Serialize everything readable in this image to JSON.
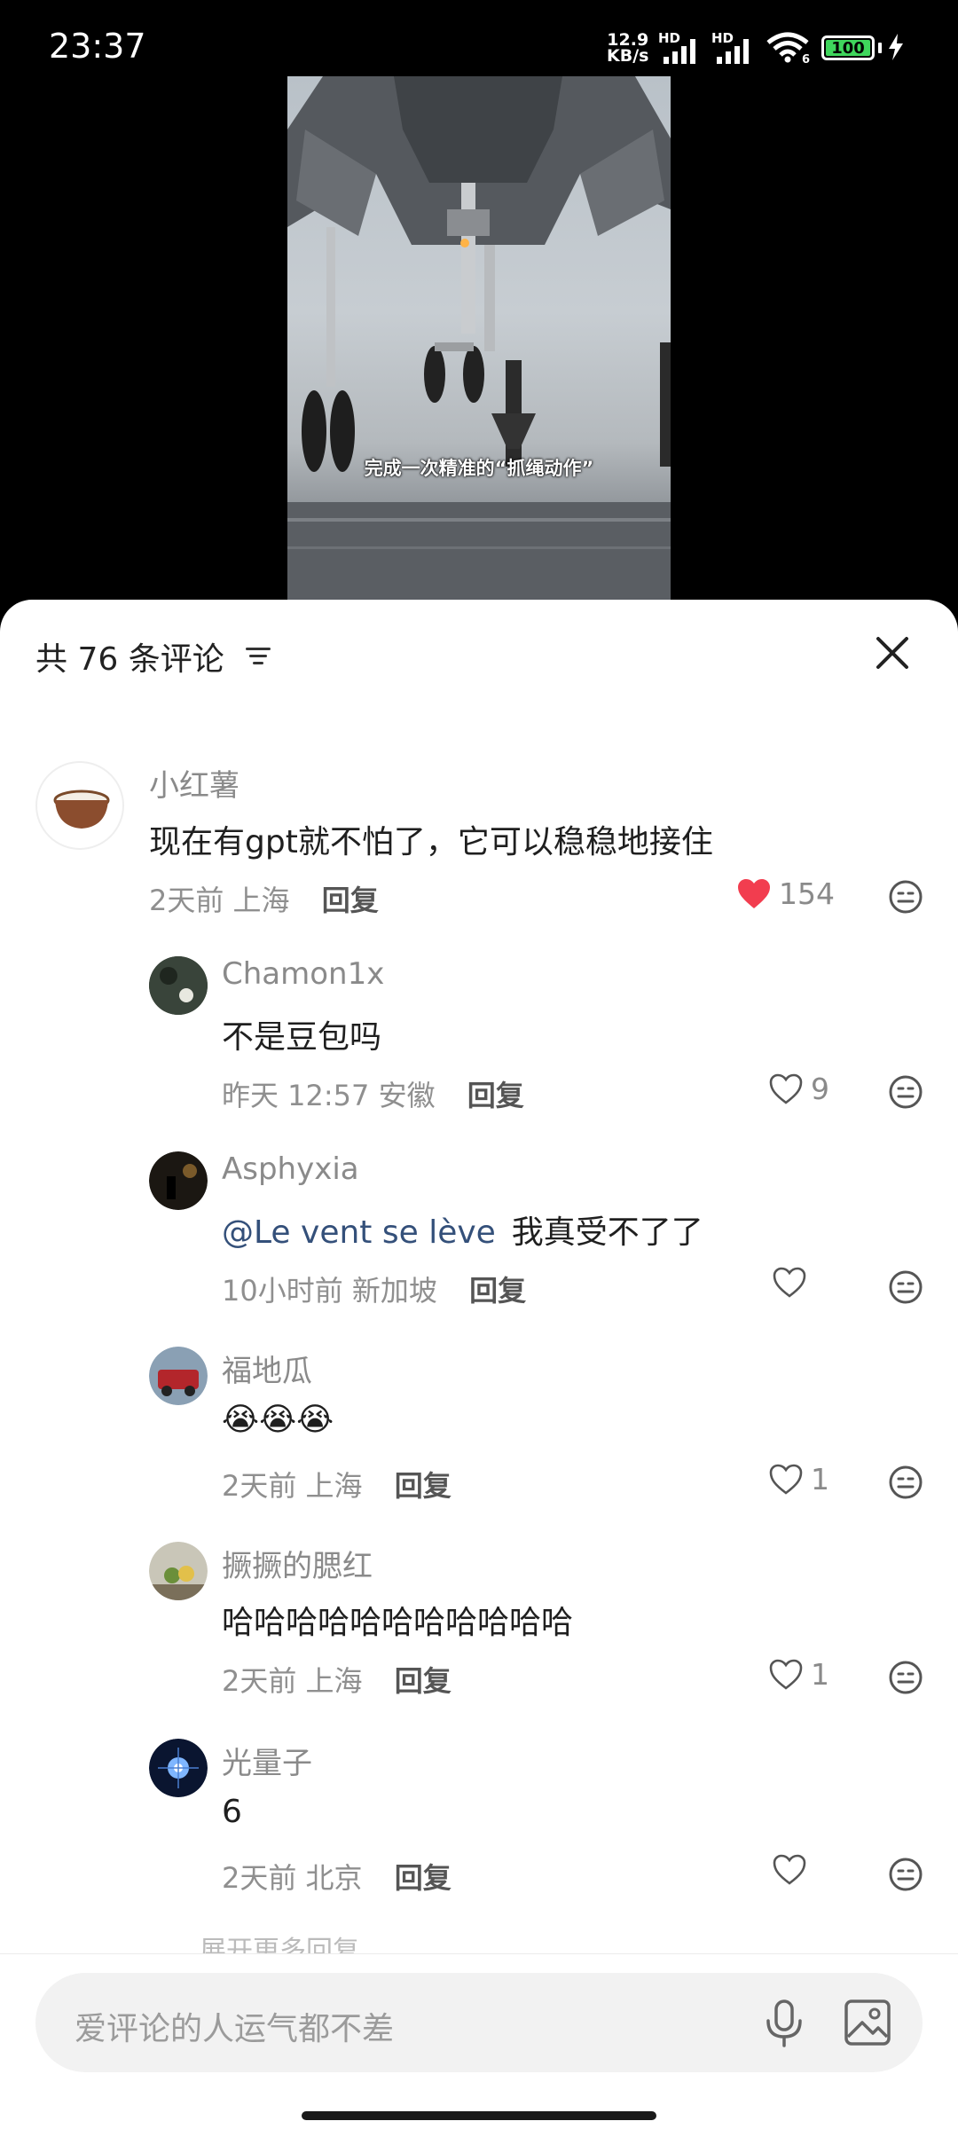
{
  "status_bar": {
    "time": "23:37",
    "net_speed_value": "12.9",
    "net_speed_unit": "KB/s",
    "sim1_label": "HD",
    "sim2_label": "HD",
    "wifi_label": "6",
    "battery": "100"
  },
  "video": {
    "caption": "完成一次精准的“抓绳动作”"
  },
  "sheet": {
    "title": "共 76 条评论"
  },
  "comments": [
    {
      "name": "小红薯",
      "text": "现在有gpt就不怕了，它可以稳稳地接住",
      "time": "2天前",
      "location": "上海",
      "reply_label": "回复",
      "likes": "154",
      "liked": true
    },
    {
      "name": "Chamon1x",
      "text": "不是豆包吗",
      "time": "昨天 12:57",
      "location": "安徽",
      "reply_label": "回复",
      "likes": "9"
    },
    {
      "name": "Asphyxia",
      "mention": "@Le vent se lève",
      "text": "我真受不了了",
      "time": "10小时前",
      "location": "新加坡",
      "reply_label": "回复",
      "likes": ""
    },
    {
      "name": "福地瓜",
      "text": "😭😭😭",
      "time": "2天前",
      "location": "上海",
      "reply_label": "回复",
      "likes": "1"
    },
    {
      "name": "撅撅的腮红",
      "text": "哈哈哈哈哈哈哈哈哈哈哈",
      "time": "2天前",
      "location": "上海",
      "reply_label": "回复",
      "likes": "1"
    },
    {
      "name": "光量子",
      "text": "6",
      "time": "2天前",
      "location": "北京",
      "reply_label": "回复",
      "likes": ""
    }
  ],
  "peek_text": "展开更多回复",
  "input": {
    "placeholder": "爱评论的人运气都不差"
  },
  "colors": {
    "liked_heart": "#f23d4f",
    "mention": "#34507a",
    "meta_text": "#8f8f8f"
  }
}
